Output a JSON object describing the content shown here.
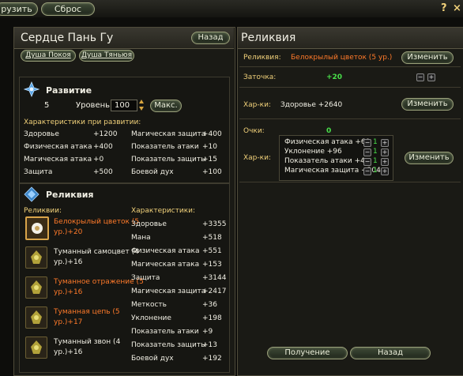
{
  "topbar": {
    "load_label": "рузить",
    "reset_label": "Сброс",
    "help": "?",
    "close": "×"
  },
  "left": {
    "title": "Сердце Пань Гу",
    "back_label": "Назад",
    "soul_tabs": [
      "Душа Покоя",
      "Душа Тяньюя"
    ],
    "development": {
      "title": "Развитие",
      "number": "5",
      "level_label": "Уровень:",
      "level_value": "100",
      "max_label": "Макс.",
      "stats_title": "Характеристики при развитии:",
      "stats": [
        {
          "n": "Здоровье",
          "v": "+1200",
          "n2": "Магическая защита",
          "v2": "+400"
        },
        {
          "n": "Физическая атака",
          "v": "+400",
          "n2": "Показатель атаки",
          "v2": "+10"
        },
        {
          "n": "Магическая атака",
          "v": "+0",
          "n2": "Показатель защиты",
          "v2": "+15"
        },
        {
          "n": "Защита",
          "v": "+500",
          "n2": "Боевой дух",
          "v2": "+100"
        }
      ]
    },
    "relic": {
      "title": "Реликвия",
      "list_label": "Реликвии:",
      "chars_label": "Характеристики:",
      "items": [
        {
          "l1": "Белокрылый цветок (5",
          "l2": "ур.)+20",
          "color": "#ff7a2a"
        },
        {
          "l1": "Туманный самоцвет (4",
          "l2": "ур.)+16",
          "color": "#f1efe4"
        },
        {
          "l1": "Туманное отражение (5",
          "l2": "ур.)+16",
          "color": "#ff7a2a"
        },
        {
          "l1": "Туманная цепь (5",
          "l2": "ур.)+17",
          "color": "#ff7a2a"
        },
        {
          "l1": "Туманный звон (4",
          "l2": "ур.)+16",
          "color": "#f1efe4"
        }
      ],
      "chars": [
        {
          "n": "Здоровье",
          "v": "+3355"
        },
        {
          "n": "Мана",
          "v": "+518"
        },
        {
          "n": "Физическая атака",
          "v": "+551"
        },
        {
          "n": "Магическая атака",
          "v": "+153"
        },
        {
          "n": "Защита",
          "v": "+3144"
        },
        {
          "n": "Магическая защита",
          "v": "+2417"
        },
        {
          "n": "Меткость",
          "v": "+36"
        },
        {
          "n": "Уклонение",
          "v": "+198"
        },
        {
          "n": "Показатель атаки",
          "v": "+9"
        },
        {
          "n": "Показатель защиты",
          "v": "+13"
        },
        {
          "n": "Боевой дух",
          "v": "+192"
        }
      ]
    }
  },
  "right": {
    "title": "Реликвия",
    "relic_label": "Реликвия:",
    "relic_value": "Белокрылый цветок (5 ур.)",
    "change_label": "Изменить",
    "sharpen_label": "Заточка:",
    "sharpen_value": "+20",
    "char1_label": "Хар-ки:",
    "char1_value": "Здоровье +2640",
    "points_label": "Очки:",
    "points_value": "0",
    "char2_label": "Хар-ки:",
    "char2_rows": [
      {
        "n": "Физическая атака +60",
        "v": "1"
      },
      {
        "n": "Уклонение +96",
        "v": "1"
      },
      {
        "n": "Показатель атаки +4",
        "v": "1"
      },
      {
        "n": "Магическая защита +204",
        "v": "1"
      }
    ],
    "receive_label": "Получение",
    "back_label": "Назад"
  },
  "colors": {
    "orange": "#ff7a2a",
    "green": "#49e04a",
    "gold": "#f1d17a"
  }
}
